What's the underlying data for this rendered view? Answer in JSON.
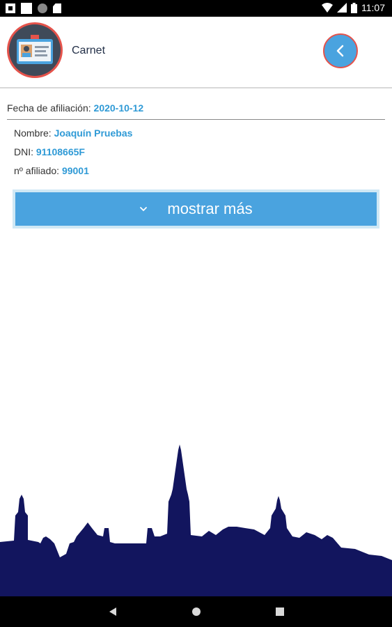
{
  "status_bar": {
    "time": "11:07",
    "icons": [
      "notification-icon",
      "square-icon",
      "circle-icon",
      "sd-card-icon",
      "wifi-icon",
      "signal-icon",
      "battery-icon"
    ]
  },
  "header": {
    "title": "Carnet",
    "avatar_icon": "id-card-icon",
    "back_icon": "chevron-left-icon"
  },
  "card": {
    "fecha_label": "Fecha de afiliación:",
    "fecha_value": "2020-10-12",
    "nombre_label": "Nombre:",
    "nombre_value": "Joaquín Pruebas",
    "dni_label": "DNI:",
    "dni_value": "91108665F",
    "afiliado_label": "nº afiliado:",
    "afiliado_value": "99001"
  },
  "more_button": {
    "label": "mostrar más",
    "icon": "chevron-down-icon"
  },
  "nav_bar": {
    "icons": [
      "back-triangle-icon",
      "home-circle-icon",
      "recents-square-icon"
    ]
  },
  "colors": {
    "accent": "#4aa3df",
    "value_text": "#2f9ad6",
    "skyline": "#12155e",
    "avatar_ring": "#e5534b"
  }
}
